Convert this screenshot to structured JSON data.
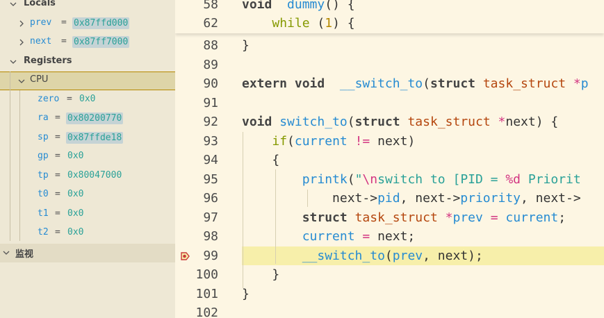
{
  "sidebar": {
    "locals_label": "Locals",
    "locals": [
      {
        "name": "prev",
        "value": "0x87ffd000"
      },
      {
        "name": "next",
        "value": "0x87ff7000"
      }
    ],
    "registers_label": "Registers",
    "cpu_label": "CPU",
    "registers": [
      {
        "name": "zero",
        "value": "0x0"
      },
      {
        "name": "ra",
        "value": "0x80200770"
      },
      {
        "name": "sp",
        "value": "0x87ffde18"
      },
      {
        "name": "gp",
        "value": "0x0"
      },
      {
        "name": "tp",
        "value": "0x80047000"
      },
      {
        "name": "t0",
        "value": "0x0"
      },
      {
        "name": "t1",
        "value": "0x0"
      },
      {
        "name": "t2",
        "value": "0x0"
      }
    ],
    "watch_label": "监视",
    "equals": "="
  },
  "editor": {
    "sticky": [
      {
        "ln": "58",
        "parts": [
          [
            "kw",
            "void"
          ],
          [
            "",
            "  "
          ],
          [
            "fn",
            "dummy"
          ],
          [
            "",
            "() {"
          ]
        ]
      },
      {
        "ln": "62",
        "parts": [
          [
            "",
            "    "
          ],
          [
            "kw2",
            "while"
          ],
          [
            "",
            " ("
          ],
          [
            "num",
            "1"
          ],
          [
            "",
            ") {"
          ]
        ]
      }
    ],
    "lines": [
      {
        "ln": "88",
        "parts": [
          [
            "",
            "}"
          ]
        ]
      },
      {
        "ln": "89",
        "parts": []
      },
      {
        "ln": "90",
        "parts": [
          [
            "kw",
            "extern void"
          ],
          [
            "",
            "  "
          ],
          [
            "fn",
            "__switch_to"
          ],
          [
            "",
            "("
          ],
          [
            "kw",
            "struct"
          ],
          [
            "",
            " "
          ],
          [
            "ty",
            "task_struct"
          ],
          [
            "",
            " "
          ],
          [
            "op",
            "*"
          ],
          [
            "var",
            "p"
          ]
        ]
      },
      {
        "ln": "91",
        "parts": []
      },
      {
        "ln": "92",
        "parts": [
          [
            "kw",
            "void"
          ],
          [
            "",
            " "
          ],
          [
            "fn",
            "switch_to"
          ],
          [
            "",
            "("
          ],
          [
            "kw",
            "struct"
          ],
          [
            "",
            " "
          ],
          [
            "ty",
            "task_struct"
          ],
          [
            "",
            " "
          ],
          [
            "op",
            "*"
          ],
          [
            "",
            "next) {"
          ]
        ]
      },
      {
        "ln": "93",
        "parts": [
          [
            "",
            "    "
          ],
          [
            "kw2",
            "if"
          ],
          [
            "",
            "("
          ],
          [
            "var",
            "current"
          ],
          [
            "",
            " "
          ],
          [
            "op",
            "!="
          ],
          [
            "",
            " next)"
          ]
        ]
      },
      {
        "ln": "94",
        "parts": [
          [
            "",
            "    {"
          ]
        ]
      },
      {
        "ln": "95",
        "parts": [
          [
            "",
            "        "
          ],
          [
            "fn",
            "printk"
          ],
          [
            "",
            "("
          ],
          [
            "str",
            "\""
          ],
          [
            "op",
            "\\n"
          ],
          [
            "str",
            "switch to [PID = "
          ],
          [
            "op",
            "%d"
          ],
          [
            "str",
            " Priorit"
          ]
        ]
      },
      {
        "ln": "96",
        "parts": [
          [
            "",
            "            next->"
          ],
          [
            "var",
            "pid"
          ],
          [
            "",
            ", next->"
          ],
          [
            "var",
            "priority"
          ],
          [
            "",
            ", next->"
          ]
        ]
      },
      {
        "ln": "97",
        "parts": [
          [
            "",
            "        "
          ],
          [
            "kw",
            "struct"
          ],
          [
            "",
            " "
          ],
          [
            "ty",
            "task_struct"
          ],
          [
            "",
            " "
          ],
          [
            "op",
            "*"
          ],
          [
            "var",
            "prev"
          ],
          [
            "",
            " "
          ],
          [
            "op",
            "="
          ],
          [
            "",
            " "
          ],
          [
            "var",
            "current"
          ],
          [
            "",
            ";"
          ]
        ]
      },
      {
        "ln": "98",
        "parts": [
          [
            "",
            "        "
          ],
          [
            "var",
            "current"
          ],
          [
            "",
            " "
          ],
          [
            "op",
            "="
          ],
          [
            "",
            " next;"
          ]
        ]
      },
      {
        "ln": "99",
        "parts": [
          [
            "",
            "        "
          ],
          [
            "fn",
            "__switch_to"
          ],
          [
            "",
            "("
          ],
          [
            "var",
            "prev"
          ],
          [
            "",
            ", next);"
          ]
        ],
        "current": true,
        "breakpoint": true
      },
      {
        "ln": "100",
        "parts": [
          [
            "",
            "    }"
          ]
        ]
      },
      {
        "ln": "101",
        "parts": [
          [
            "",
            "}"
          ]
        ]
      },
      {
        "ln": "102",
        "parts": []
      }
    ]
  }
}
